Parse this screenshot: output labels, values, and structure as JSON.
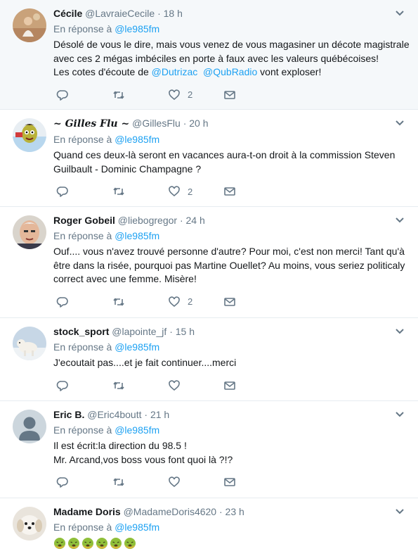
{
  "tweets": [
    {
      "name": "Cécile",
      "handle": "@LavraieCecile",
      "sep": "·",
      "time": "18 h",
      "reply_prefix": "En réponse à",
      "reply_to": "@le985fm",
      "lines": [
        "Désolé de vous le dire, mais vous venez de vous magasiner un décote magistrale",
        "avec ces 2 mégas imbéciles en porte à faux avec les valeurs québécoises!"
      ],
      "line3_prefix": "Les cotes d'écoute de ",
      "mention1": "@Dutrizac",
      "mention2": "@QubRadio",
      "line3_suffix": " vont exploser!",
      "likes": "2"
    },
    {
      "name": "~ Gilles Flu ~",
      "handle": "@GillesFlu",
      "sep": "·",
      "time": "20 h",
      "reply_prefix": "En réponse à",
      "reply_to": "@le985fm",
      "lines": [
        "Quand ces deux-là seront en vacances aura-t-on droit à la commission Steven",
        "Guilbault - Dominic Champagne ?"
      ],
      "likes": "2"
    },
    {
      "name": "Roger Gobeil",
      "handle": "@liebogregor",
      "sep": "·",
      "time": "24 h",
      "reply_prefix": "En réponse à",
      "reply_to": "@le985fm",
      "lines": [
        "Ouf.... vous n'avez trouvé personne d'autre? Pour moi, c'est non merci! Tant qu'à",
        "être dans la risée, pourquoi pas Martine Ouellet? Au moins, vous seriez politicaly",
        "correct avec une femme. Misère!"
      ],
      "likes": "2"
    },
    {
      "name": "stock_sport",
      "handle": "@lapointe_jf",
      "sep": "·",
      "time": "15 h",
      "reply_prefix": "En réponse à",
      "reply_to": "@le985fm",
      "lines": [
        "J'ecoutait pas....et je fait continuer....merci"
      ],
      "likes": ""
    },
    {
      "name": "Eric B.",
      "handle": "@Eric4boutt",
      "sep": "·",
      "time": "21 h",
      "reply_prefix": "En réponse à",
      "reply_to": "@le985fm",
      "lines": [
        "Il est écrit:la direction du 98.5 !",
        "Mr. Arcand,vos boss vous font quoi là ?!?"
      ],
      "likes": ""
    },
    {
      "name": "Madame Doris",
      "handle": "@MadameDoris4620",
      "sep": "·",
      "time": "23 h",
      "reply_prefix": "En réponse à",
      "reply_to": "@le985fm",
      "emoji_name": "nauseated-face-emoji"
    }
  ],
  "colors": {
    "link": "#1da1f2",
    "muted": "#657786",
    "text": "#14171a",
    "highlight_bg": "#f5f8fa",
    "emoji_green": "#8fbf3a",
    "emoji_skin": "#f2b13b"
  },
  "icons": [
    "reply-icon",
    "retweet-icon",
    "like-icon",
    "message-icon",
    "chevron-down-icon"
  ]
}
